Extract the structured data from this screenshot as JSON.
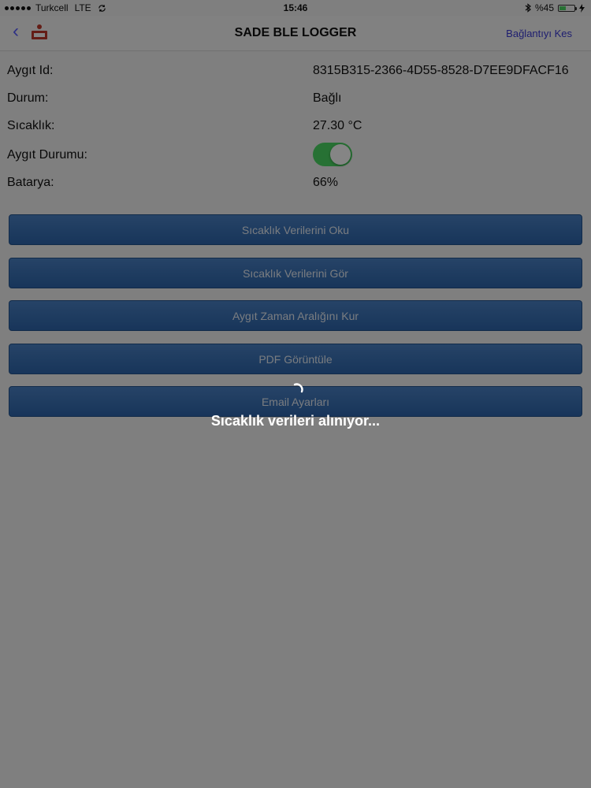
{
  "status_bar": {
    "carrier": "Turkcell",
    "network": "LTE",
    "time": "15:46",
    "battery_percent": "%45",
    "battery_level": 0.45,
    "icons": [
      "signal-dots-icon",
      "sync-icon",
      "bluetooth-icon",
      "battery-icon",
      "charging-icon"
    ]
  },
  "nav": {
    "title": "SADE BLE LOGGER",
    "right_button": "Bağlantıyı Kes",
    "back_icon": "chevron-left-icon",
    "logo_icon": "app-logo-icon"
  },
  "info": {
    "device_id_label": "Aygıt Id:",
    "device_id_value": "8315B315-2366-4D55-8528-D7EE9DFACF16",
    "status_label": "Durum:",
    "status_value": "Bağlı",
    "temperature_label": "Sıcaklık:",
    "temperature_value": "27.30 °C",
    "device_state_label": "Aygıt Durumu:",
    "device_state_on": true,
    "battery_label": "Batarya:",
    "battery_value": "66%"
  },
  "buttons": {
    "read_temps": "Sıcaklık Verilerini Oku",
    "view_temps": "Sıcaklık Verilerini Gör",
    "set_interval": "Aygıt Zaman Aralığını Kur",
    "view_pdf": "PDF Görüntüle",
    "email_settings": "Email Ayarları"
  },
  "overlay": {
    "loading_text": "Sıcaklık verileri alınıyor..."
  },
  "colors": {
    "accent": "#3b3bd6",
    "button_blue": "#3a72b9",
    "toggle_green": "#4cd964"
  }
}
